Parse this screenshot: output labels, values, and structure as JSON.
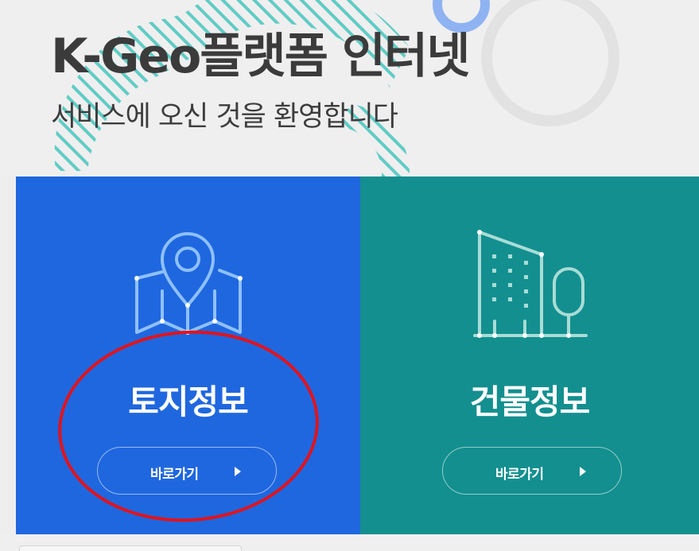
{
  "hero": {
    "title": "K-Geo플랫폼 인터넷",
    "subtitle": "서비스에 오신 것을 환영합니다"
  },
  "cards": [
    {
      "title": "토지정보",
      "button_label": "바로가기",
      "icon": "map-pin-icon",
      "color": "#1f67df"
    },
    {
      "title": "건물정보",
      "button_label": "바로가기",
      "icon": "building-icon",
      "color": "#138f8f"
    }
  ],
  "annotation": {
    "type": "red-ellipse",
    "color": "#e0141e",
    "target": "land-info-card"
  }
}
